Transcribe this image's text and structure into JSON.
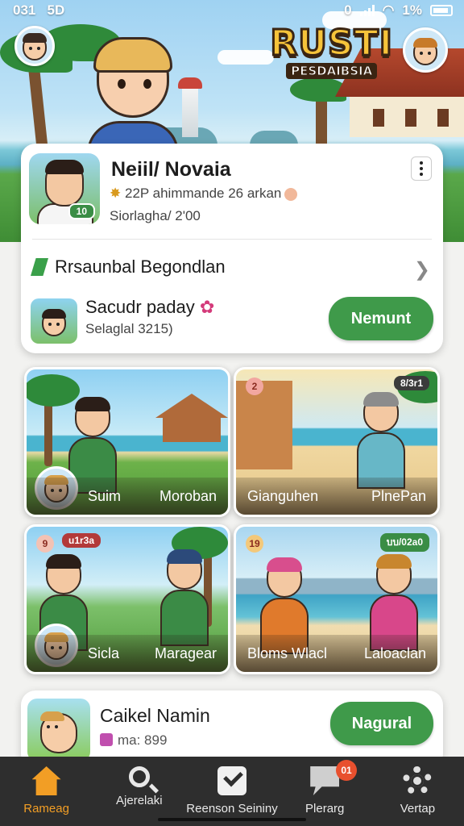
{
  "status_bar": {
    "time": "031",
    "network": "5D",
    "right": "0",
    "battery": "1%"
  },
  "logo": {
    "title": "RUSTI",
    "subtitle": "PESDAIBSIA"
  },
  "profile": {
    "name": "Neiil/ Novaia",
    "stats": "22P ahimmande 26 arkan",
    "status": "Siorlagha/ 2'00",
    "photo_tag": "10",
    "suggestion": "Rrsaunbal Begondlan",
    "activity_title": "Sacudr paday",
    "activity_sub": "Selaglal 3215)",
    "action_label": "Nemunt"
  },
  "tiles": [
    {
      "left": "Suim",
      "right": "Moroban",
      "badge": "",
      "number": ""
    },
    {
      "left": "Gianguhen",
      "right": "PlnePan",
      "badge": "8/3r1",
      "number": "2"
    },
    {
      "left": "Sicla",
      "right": "Maragear",
      "badge": "u1r3a",
      "number": "9"
    },
    {
      "left": "Bloms Wlacl",
      "right": "Laloaclan",
      "badge": "บบ/02a0",
      "number": "19"
    }
  ],
  "bottom_card": {
    "title": "Caikel Namin",
    "sub": "ma: 899",
    "action_label": "Nagural"
  },
  "tabs": [
    {
      "label": "Rameag",
      "icon": "home-icon",
      "active": true
    },
    {
      "label": "Ajerelaki",
      "icon": "search-icon"
    },
    {
      "label": "Reenson Seininy",
      "icon": "check-icon"
    },
    {
      "label": "Plerarg",
      "icon": "chat-icon",
      "badge": "01"
    },
    {
      "label": "Vertap",
      "icon": "gear-icon"
    }
  ],
  "colors": {
    "accent": "#f29e25",
    "green": "#3f9a4a",
    "tabbar": "#2e2e2e"
  }
}
